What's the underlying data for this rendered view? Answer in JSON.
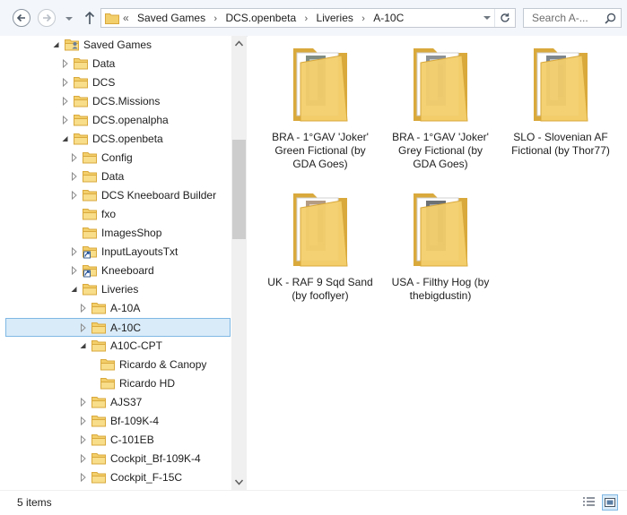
{
  "nav": {
    "back_icon": "back-arrow-icon",
    "forward_icon": "forward-arrow-icon",
    "recent_icon": "chevron-down-icon",
    "up_icon": "up-arrow-icon"
  },
  "address": {
    "overflow": "«",
    "crumbs": [
      "Saved Games",
      "DCS.openbeta",
      "Liveries",
      "A-10C"
    ],
    "separator": "›"
  },
  "search": {
    "placeholder": "Search A-..."
  },
  "tree": {
    "rows": [
      {
        "label": "Saved Games",
        "level": 0,
        "expand": "open",
        "icon": "user-folder"
      },
      {
        "label": "Data",
        "level": 1,
        "expand": "closed",
        "icon": "folder"
      },
      {
        "label": "DCS",
        "level": 1,
        "expand": "closed",
        "icon": "folder"
      },
      {
        "label": "DCS.Missions",
        "level": 1,
        "expand": "closed",
        "icon": "folder"
      },
      {
        "label": "DCS.openalpha",
        "level": 1,
        "expand": "closed",
        "icon": "folder"
      },
      {
        "label": "DCS.openbeta",
        "level": 1,
        "expand": "open",
        "icon": "folder"
      },
      {
        "label": "Config",
        "level": 2,
        "expand": "closed",
        "icon": "folder"
      },
      {
        "label": "Data",
        "level": 2,
        "expand": "closed",
        "icon": "folder"
      },
      {
        "label": "DCS Kneeboard Builder",
        "level": 2,
        "expand": "closed",
        "icon": "folder"
      },
      {
        "label": "fxo",
        "level": 2,
        "expand": "none",
        "icon": "folder"
      },
      {
        "label": "ImagesShop",
        "level": 2,
        "expand": "none",
        "icon": "folder"
      },
      {
        "label": "InputLayoutsTxt",
        "level": 2,
        "expand": "closed",
        "icon": "shortcut-folder"
      },
      {
        "label": "Kneeboard",
        "level": 2,
        "expand": "closed",
        "icon": "shortcut-folder"
      },
      {
        "label": "Liveries",
        "level": 2,
        "expand": "open",
        "icon": "folder"
      },
      {
        "label": "A-10A",
        "level": 3,
        "expand": "closed",
        "icon": "folder"
      },
      {
        "label": "A-10C",
        "level": 3,
        "expand": "closed",
        "icon": "folder",
        "selected": true
      },
      {
        "label": "A10C-CPT",
        "level": 3,
        "expand": "open",
        "icon": "folder"
      },
      {
        "label": "Ricardo & Canopy",
        "level": 4,
        "expand": "none",
        "icon": "folder"
      },
      {
        "label": "Ricardo HD",
        "level": 4,
        "expand": "none",
        "icon": "folder"
      },
      {
        "label": "AJS37",
        "level": 3,
        "expand": "closed",
        "icon": "folder"
      },
      {
        "label": "Bf-109K-4",
        "level": 3,
        "expand": "closed",
        "icon": "folder"
      },
      {
        "label": "C-101EB",
        "level": 3,
        "expand": "closed",
        "icon": "folder"
      },
      {
        "label": "Cockpit_Bf-109K-4",
        "level": 3,
        "expand": "closed",
        "icon": "folder"
      },
      {
        "label": "Cockpit_F-15C",
        "level": 3,
        "expand": "closed",
        "icon": "folder"
      }
    ]
  },
  "content": {
    "items": [
      {
        "name": "BRA - 1°GAV 'Joker'  Green Fictional (by GDA Goes)",
        "thumb": "green"
      },
      {
        "name": "BRA - 1°GAV 'Joker'  Grey Fictional (by GDA Goes)",
        "thumb": "grey"
      },
      {
        "name": "SLO - Slovenian AF Fictional (by Thor77)",
        "thumb": "slate"
      },
      {
        "name": "UK - RAF 9 Sqd Sand (by fooflyer)",
        "thumb": "sand"
      },
      {
        "name": "USA - Filthy Hog (by thebigdustin)",
        "thumb": "dark"
      }
    ]
  },
  "status": {
    "count": "5 items",
    "details_view_icon": "details-view-icon",
    "large_icons_view_icon": "large-icons-view-icon"
  },
  "colors": {
    "folder": "#f3cf6b",
    "folder_dark": "#d9a93c",
    "selection_bg": "#d9ebf9",
    "selection_border": "#80b8e4"
  }
}
